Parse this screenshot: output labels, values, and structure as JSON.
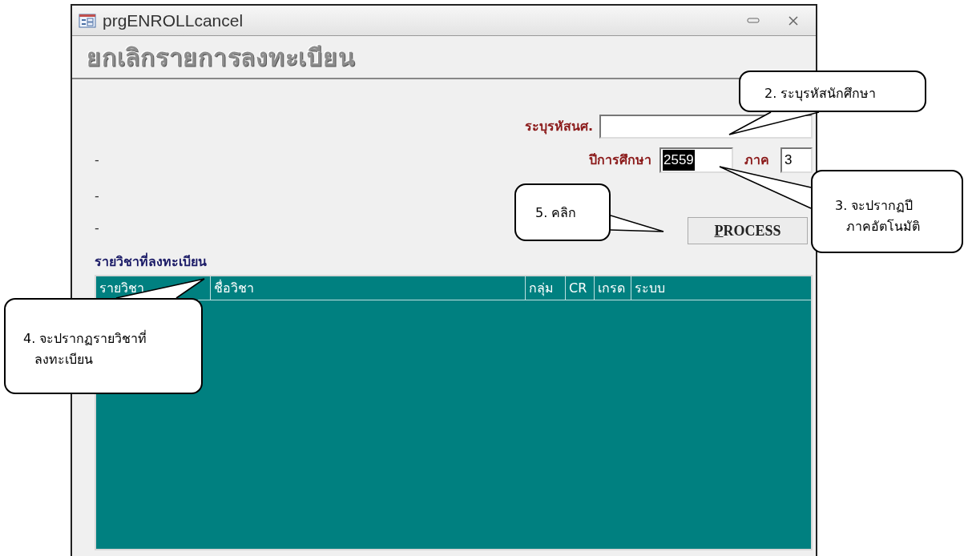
{
  "window": {
    "title": "prgENROLLcancel",
    "heading": "ยกเลิกรายการลงทะเบียน"
  },
  "form": {
    "student_id": {
      "label": "ระบุรหัสนศ."
    },
    "year": {
      "label": "ปีการศึกษา",
      "value": "2559",
      "selected": true
    },
    "term": {
      "label": "ภาค",
      "value": "3"
    },
    "dashes": [
      "-",
      "-",
      "-"
    ],
    "process_button": {
      "label": "PROCESS"
    }
  },
  "list": {
    "title": "รายวิชาที่ลงทะเบียน",
    "columns": [
      "รายวิชา",
      "ชื่อวิชา",
      "กลุ่ม",
      "CR",
      "เกรด",
      "ระบบ"
    ]
  },
  "callouts": [
    {
      "lines": [
        "2. ระบุรหัสนักศึกษา"
      ]
    },
    {
      "lines": [
        "5. คลิก"
      ]
    },
    {
      "lines": [
        "3. จะปรากฏปี",
        "ภาคอัตโนมัติ"
      ]
    },
    {
      "lines": [
        "4. จะปรากฏรายวิชาที่",
        "ลงทะเบียน"
      ]
    }
  ]
}
